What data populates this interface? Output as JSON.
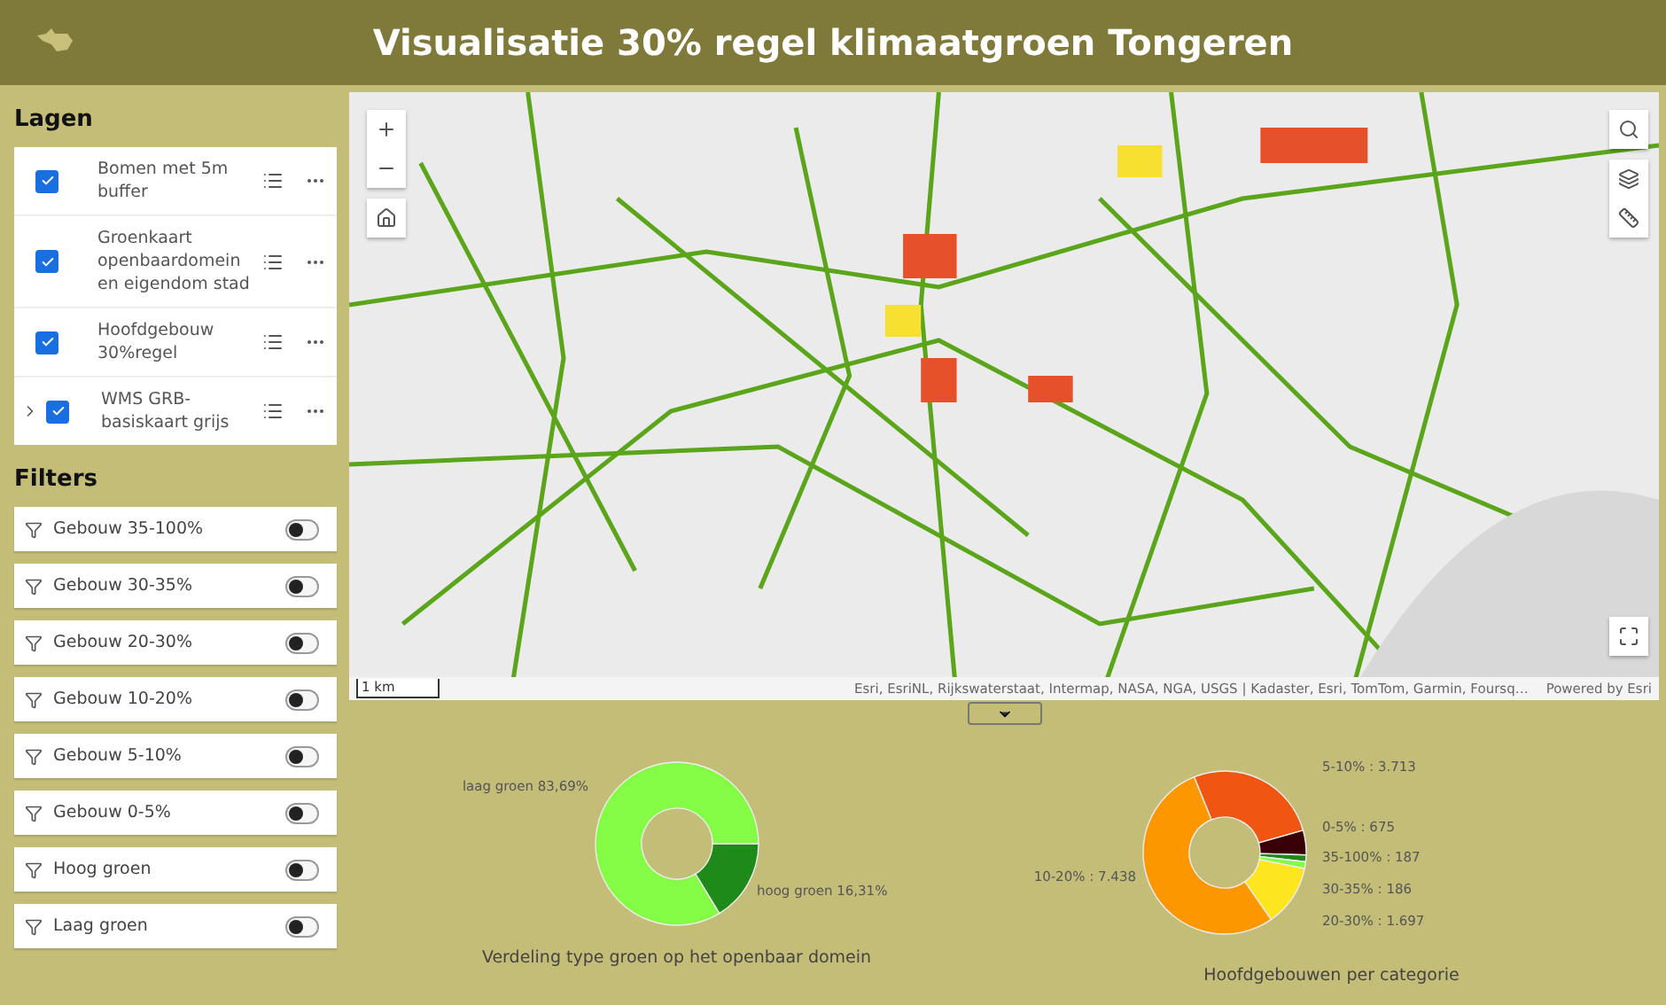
{
  "header": {
    "title": "Visualisatie 30% regel klimaatgroen Tongeren"
  },
  "layers": {
    "title": "Lagen",
    "items": [
      {
        "label": "Bomen met 5m buffer",
        "checked": true,
        "expandable": false
      },
      {
        "label": "Groenkaart openbaardomein en eigendom stad",
        "checked": true,
        "expandable": false
      },
      {
        "label": "Hoofdgebouw 30%regel",
        "checked": true,
        "expandable": false
      },
      {
        "label": "WMS GRB-basiskaart grijs",
        "checked": true,
        "expandable": true
      }
    ]
  },
  "filters": {
    "title": "Filters",
    "items": [
      {
        "label": "Gebouw 35-100%",
        "on": false
      },
      {
        "label": "Gebouw 30-35%",
        "on": false
      },
      {
        "label": "Gebouw 20-30%",
        "on": false
      },
      {
        "label": "Gebouw 10-20%",
        "on": false
      },
      {
        "label": "Gebouw 5-10%",
        "on": false
      },
      {
        "label": "Gebouw 0-5%",
        "on": false
      },
      {
        "label": "Hoog groen",
        "on": false
      },
      {
        "label": "Laag groen",
        "on": false
      }
    ]
  },
  "map": {
    "scale": "1 km",
    "attribution": "Esri, EsriNL, Rijkswaterstaat, Intermap, NASA, NGA, USGS | Kadaster, Esri, TomTom, Garmin, Foursq…",
    "powered_by": "Powered by Esri"
  },
  "charts": [
    {
      "caption": "Verdeling type groen op het openbaar domein",
      "chart_data": {
        "type": "donut",
        "categories": [
          "hoog groen",
          "laag groen"
        ],
        "values": [
          16.31,
          83.69
        ],
        "value_labels": [
          "16,31%",
          "83,69%"
        ],
        "colors": [
          "#1e8a1a",
          "#84fb44"
        ]
      }
    },
    {
      "caption": "Hoofdgebouwen per categorie",
      "chart_data": {
        "type": "donut",
        "categories": [
          "5-10%",
          "0-5%",
          "35-100%",
          "30-35%",
          "20-30%",
          "10-20%"
        ],
        "values": [
          3713,
          675,
          187,
          186,
          1697,
          7438
        ],
        "value_labels": [
          "3.713",
          "675",
          "187",
          "186",
          "1.697",
          "7.438"
        ],
        "colors": [
          "#f05512",
          "#3a0008",
          "#1e8a1a",
          "#84fb44",
          "#fde620",
          "#fd9700"
        ]
      }
    }
  ]
}
